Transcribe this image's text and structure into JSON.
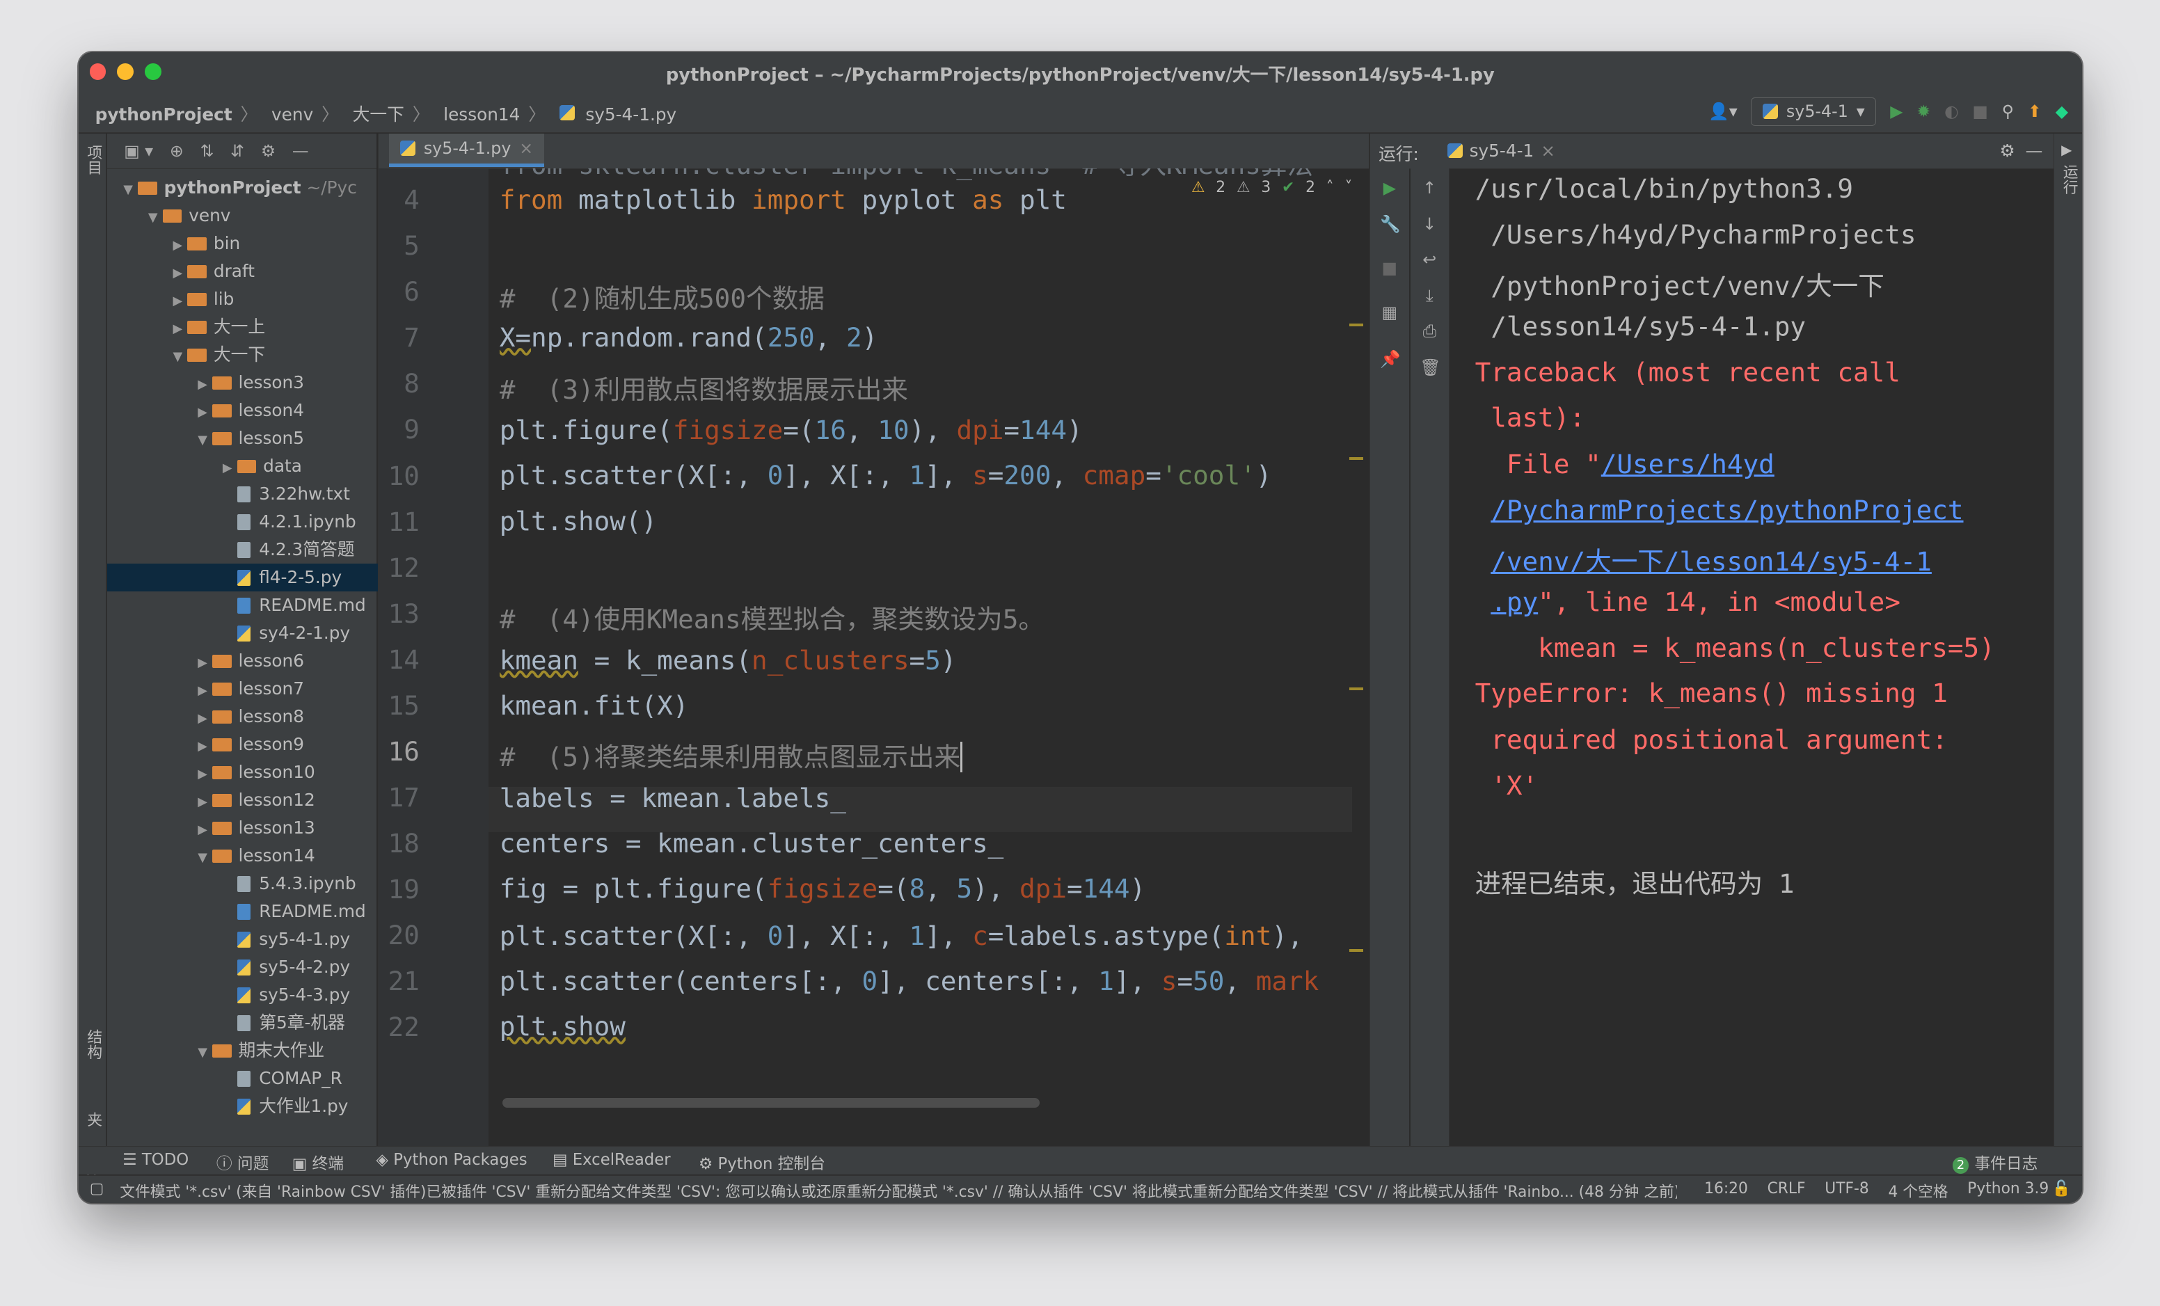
{
  "window": {
    "title": "pythonProject – ~/PycharmProjects/pythonProject/venv/大一下/lesson14/sy5-4-1.py"
  },
  "breadcrumb": [
    "pythonProject",
    "venv",
    "大一下",
    "lesson14",
    "sy5-4-1.py"
  ],
  "run_config": "sy5-4-1",
  "left_strip": {
    "project": "项目",
    "structure": "结构",
    "favorites": "收藏夹"
  },
  "right_strip": {
    "run": "运行"
  },
  "project_tree": {
    "root": "pythonProject",
    "root_path": "~/Pyc",
    "items": [
      {
        "label": "venv"
      },
      {
        "label": "bin"
      },
      {
        "label": "draft"
      },
      {
        "label": "lib"
      },
      {
        "label": "大一上"
      },
      {
        "label": "大一下"
      },
      {
        "label": "lesson3"
      },
      {
        "label": "lesson4"
      },
      {
        "label": "lesson5"
      },
      {
        "label": "data"
      },
      {
        "label": "3.22hw.txt"
      },
      {
        "label": "4.2.1.ipynb"
      },
      {
        "label": "4.2.3简答题"
      },
      {
        "label": "fl4-2-5.py"
      },
      {
        "label": "README.md"
      },
      {
        "label": "sy4-2-1.py"
      },
      {
        "label": "lesson6"
      },
      {
        "label": "lesson7"
      },
      {
        "label": "lesson8"
      },
      {
        "label": "lesson9"
      },
      {
        "label": "lesson10"
      },
      {
        "label": "lesson12"
      },
      {
        "label": "lesson13"
      },
      {
        "label": "lesson14"
      },
      {
        "label": "5.4.3.ipynb"
      },
      {
        "label": "README.md"
      },
      {
        "label": "sy5-4-1.py"
      },
      {
        "label": "sy5-4-2.py"
      },
      {
        "label": "sy5-4-3.py"
      },
      {
        "label": "第5章-机器"
      },
      {
        "label": "期末大作业"
      },
      {
        "label": "COMAP_R"
      },
      {
        "label": "大作业1.py"
      }
    ]
  },
  "editor": {
    "tab": "sy5-4-1.py",
    "inspections": {
      "warnings": "2",
      "weak": "3",
      "ok": "2"
    },
    "line_numbers": [
      "4",
      "5",
      "6",
      "7",
      "8",
      "9",
      "10",
      "11",
      "12",
      "13",
      "14",
      "15",
      "16",
      "17",
      "18",
      "19",
      "20",
      "21",
      "22"
    ],
    "current_line": "16",
    "partial_top_line": "from sklearn.cluster import k_means  # 导入KMeans算法"
  },
  "run_panel": {
    "label": "运行:",
    "tab": "sy5-4-1",
    "output": {
      "cmd1": "/usr/local/bin/python3.9",
      "cmd2": " /Users/h4yd/PycharmProjects",
      "cmd3": " /pythonProject/venv/大一下",
      "cmd4": " /lesson14/sy5-4-1.py",
      "tb1": "Traceback (most recent call",
      "tb2": " last):",
      "file_prefix": "  File \"",
      "link1": "/Users/h4yd",
      "link2": "/PycharmProjects/pythonProject",
      "link3": "/venv/大一下/lesson14/sy5-4-1",
      "link4": ".py",
      "file_suffix": "\", line 14, in <module>",
      "src": "    kmean = k_means(n_clusters=5)",
      "err1": "TypeError: k_means() missing 1",
      "err2": " required positional argument:",
      "err3": " 'X'",
      "exit": "进程已结束，退出代码为 1"
    }
  },
  "bottom_toolbar": {
    "todo": "TODO",
    "problems": "问题",
    "terminal": "终端",
    "packages": "Python Packages",
    "excel": "ExcelReader",
    "console": "Python 控制台",
    "event_log_count": "2",
    "event_log": "事件日志"
  },
  "status": {
    "message": "文件模式 '*.csv' (来自 'Rainbow CSV' 插件)已被插件 'CSV' 重新分配给文件类型 'CSV': 您可以确认或还原重新分配模式 '*.csv' // 确认从插件 'CSV' 将此模式重新分配给文件类型 'CSV' // 将此模式从插件 'Rainbo... (48 分钟 之前)",
    "position": "16:20",
    "line_sep": "CRLF",
    "encoding": "UTF-8",
    "indent": "4 个空格",
    "interpreter": "Python 3.9"
  },
  "colors": {
    "editor_bg": "#2b2b2b",
    "panel_bg": "#3c3f41",
    "keyword": "#cc7832",
    "number": "#6897bb",
    "string": "#6a8759",
    "comment": "#808080",
    "error": "#ff6b68",
    "link": "#5894ff"
  }
}
